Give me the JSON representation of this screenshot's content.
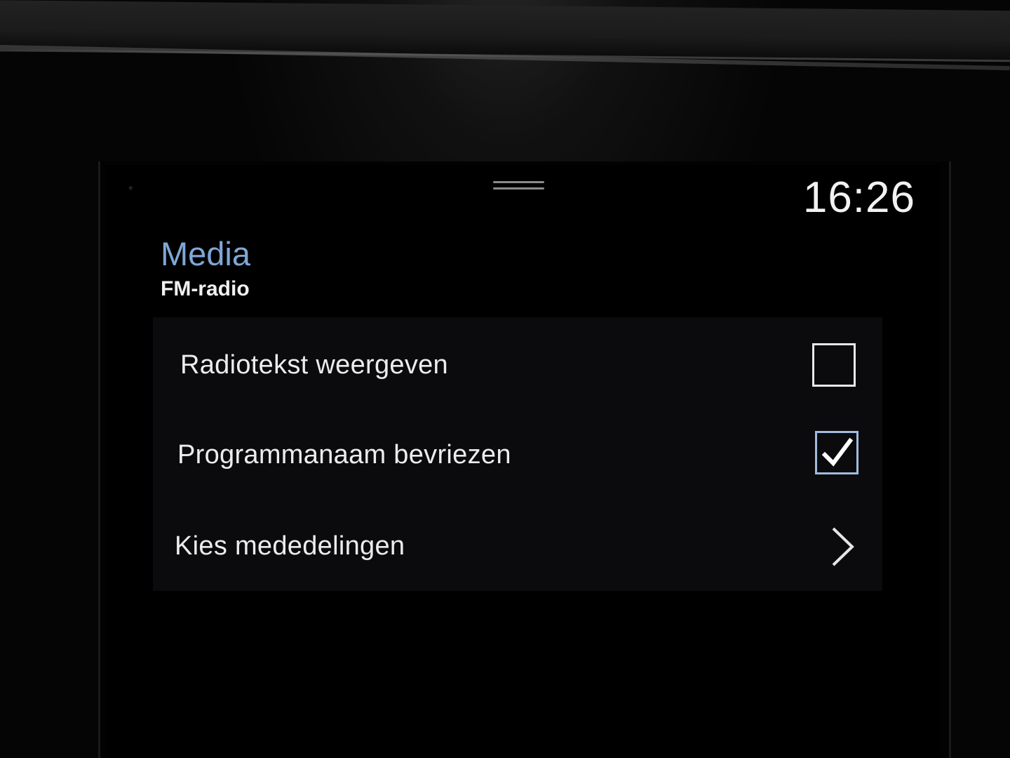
{
  "status": {
    "clock": "16:26"
  },
  "header": {
    "title": "Media",
    "subtitle": "FM-radio"
  },
  "settings": {
    "items": [
      {
        "label": "Radiotekst weergeven",
        "control": "checkbox",
        "checked": false
      },
      {
        "label": "Programmanaam bevriezen",
        "control": "checkbox",
        "checked": true
      },
      {
        "label": "Kies mededelingen",
        "control": "chevron"
      }
    ]
  },
  "colors": {
    "title_accent": "#7fa7d6",
    "checked_border": "#9fbbe0",
    "background": "#000000",
    "text": "#ececec"
  },
  "icons": {
    "handle": "drag-handle-icon",
    "checkbox_checked": "check-icon",
    "chevron": "chevron-right-icon",
    "bluetooth": "bluetooth-icon"
  }
}
